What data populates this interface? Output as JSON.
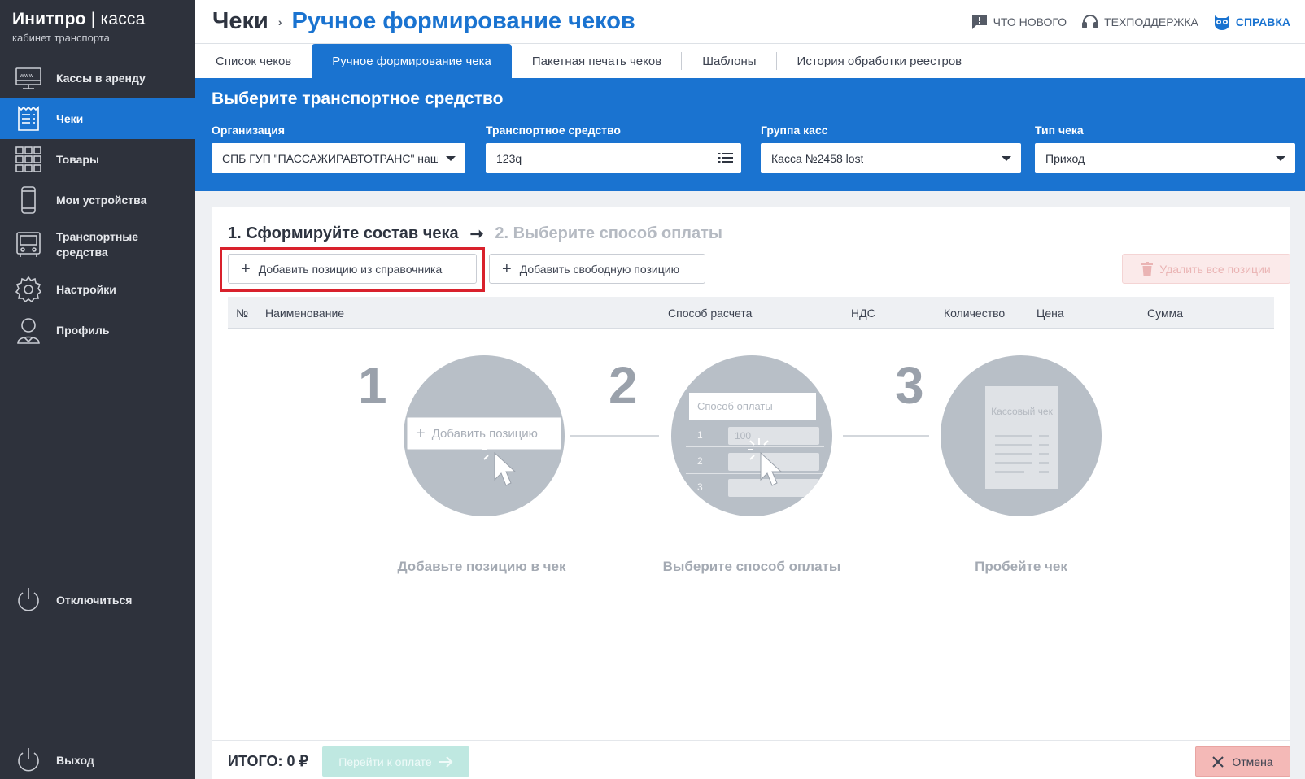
{
  "brand": {
    "name": "Инитпро",
    "divider": "|",
    "product": "касса",
    "subtitle": "кабинет транспорта"
  },
  "sidebar": {
    "items": [
      {
        "label": "Кассы в аренду",
        "icon": "www-monitor-icon"
      },
      {
        "label": "Чеки",
        "icon": "receipt-icon",
        "active": true
      },
      {
        "label": "Товары",
        "icon": "grid-icon"
      },
      {
        "label": "Мои устройства",
        "icon": "phone-icon"
      },
      {
        "label": "Транспортные средства",
        "icon": "bus-icon"
      },
      {
        "label": "Настройки",
        "icon": "gear-icon"
      },
      {
        "label": "Профиль",
        "icon": "user-icon"
      }
    ],
    "logout": "Отключиться",
    "exit": "Выход"
  },
  "header": {
    "crumb_root": "Чеки",
    "crumb_sep": "›",
    "crumb_current": "Ручное формирование чеков",
    "links": {
      "whats_new": "Что нового",
      "support": "Техподдержка",
      "help": "Справка"
    }
  },
  "tabs": [
    {
      "label": "Список чеков"
    },
    {
      "label": "Ручное формирование чека",
      "active": true
    },
    {
      "label": "Пакетная печать чеков"
    },
    {
      "label": "Шаблоны"
    },
    {
      "label": "История обработки реестров"
    }
  ],
  "selector": {
    "title": "Выберите транспортное средство",
    "org": {
      "label": "Организация",
      "value": "СПБ ГУП \"ПАССАЖИРАВТОТРАНС\" наш"
    },
    "vehicle": {
      "label": "Транспортное средство",
      "value": "123q"
    },
    "group": {
      "label": "Группа касс",
      "value": "Касса №2458 lost"
    },
    "type": {
      "label": "Тип чека",
      "value": "Приход"
    }
  },
  "composer": {
    "step1": "1. Сформируйте состав чека",
    "arrow": "➞",
    "step2": "2. Выберите способ оплаты",
    "add_from_ref": "Добавить позицию из справочника",
    "add_free": "Добавить свободную позицию",
    "delete_all": "Удалить все позиции",
    "columns": {
      "num": "№",
      "name": "Наименование",
      "method": "Способ расчета",
      "vat": "НДС",
      "qty": "Количество",
      "price": "Цена",
      "sum": "Сумма"
    }
  },
  "illustration": {
    "n1": "1",
    "n2": "2",
    "n3": "3",
    "mock_add": "Добавить позицию",
    "mock_pay_head": "Способ оплаты",
    "mock_rows": [
      "1",
      "2",
      "3"
    ],
    "mock_value": "100",
    "receipt_text": "Кассовый чек",
    "cap1": "Добавьте позицию в чек",
    "cap2": "Выберите способ оплаты",
    "cap3": "Пробейте чек"
  },
  "footer": {
    "total": "ИТОГО: 0 ₽",
    "pay": "Перейти к оплате",
    "cancel": "Отмена"
  },
  "colors": {
    "sidebar": "#2e323c",
    "accent": "#1a73d0",
    "highlight": "#d9212c",
    "pay_disabled": "#bfe8e1",
    "cancel": "#f4b9b7"
  }
}
